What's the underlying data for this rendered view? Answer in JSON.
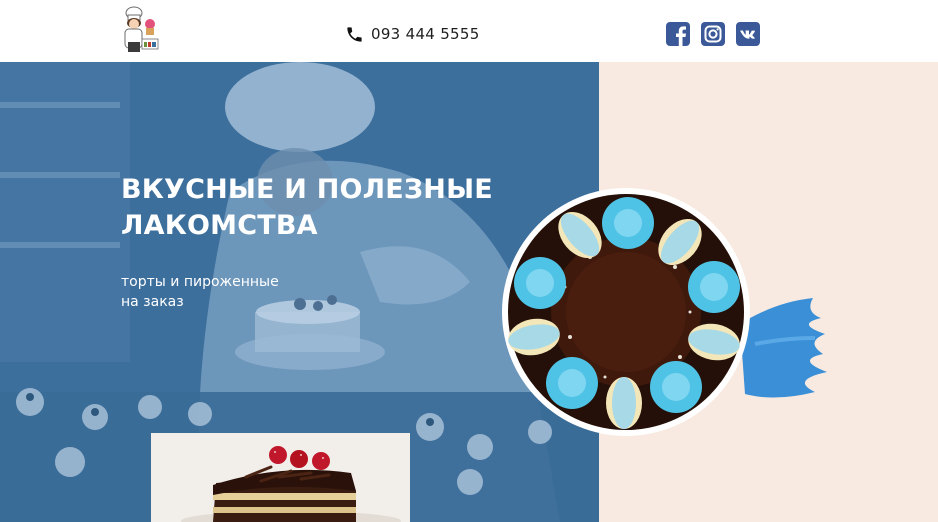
{
  "header": {
    "logo": {
      "name": "bakery-chef-logo",
      "badge_text": "Pet'S"
    },
    "phone": {
      "icon": "phone-icon",
      "number": "093 444 5555"
    },
    "social": [
      {
        "name": "facebook",
        "icon": "facebook-icon",
        "color": "#3b5998"
      },
      {
        "name": "instagram",
        "icon": "instagram-icon",
        "color": "#3b5998"
      },
      {
        "name": "vk",
        "icon": "vk-icon",
        "color": "#3b5998"
      }
    ]
  },
  "hero": {
    "title_line1": "ВКУСНЫЕ И ПОЛЕЗНЫЕ",
    "title_line2": "ЛАКОМСТВА",
    "subtitle_line1": "торты и пироженные",
    "subtitle_line2": "на заказ"
  },
  "colors": {
    "overlay_blue": "#3b6f9c",
    "right_panel": "#f8eae1",
    "brush_blue": "#3a8fd6",
    "macaron_cream": "#f3e6b8",
    "meringue_blue": "#4fc3e6",
    "chocolate": "#3a1d12"
  }
}
